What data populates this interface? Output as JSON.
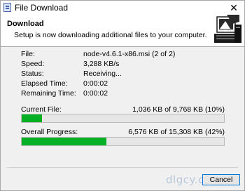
{
  "window": {
    "title": "File Download",
    "close_glyph": "✕"
  },
  "header": {
    "title": "Download",
    "subtitle": "Setup is now downloading additional files to your computer.",
    "logo_icon": "computer-download-icon"
  },
  "details": [
    {
      "label": "File:",
      "value": "node-v4.6.1-x86.msi (2 of 2)"
    },
    {
      "label": "Speed:",
      "value": "3,288 KB/s"
    },
    {
      "label": "Status:",
      "value": "Receiving..."
    },
    {
      "label": "Elapsed Time:",
      "value": "0:00:02"
    },
    {
      "label": "Remaining Time:",
      "value": "0:00:02"
    }
  ],
  "current_file": {
    "label": "Current File:",
    "info": "1,036 KB of 9,768 KB (10%)",
    "progress": 0.1
  },
  "overall": {
    "label": "Overall Progress:",
    "info": "6,576 KB of 15,308 KB (42%)",
    "progress": 0.42
  },
  "buttons": {
    "cancel": "Cancel"
  },
  "watermark": "dlgcy.com",
  "colors": {
    "progress": "#06b025",
    "focus_border": "#0078d7"
  }
}
